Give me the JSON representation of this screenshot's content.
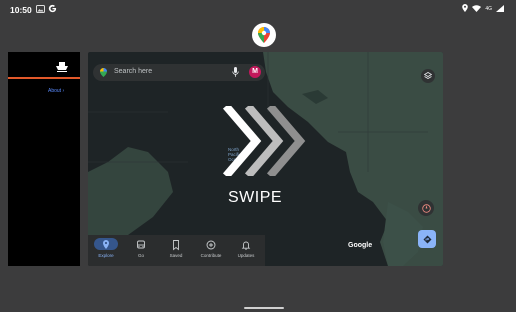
{
  "status_bar": {
    "time": "10:50",
    "network": "4G"
  },
  "left_card": {
    "about_link": "About ›"
  },
  "maps": {
    "search_placeholder": "Search here",
    "avatar_letter": "M",
    "swipe_label": "SWIPE",
    "attribution": "Google",
    "ocean_label": "North\nPacific\nOcean",
    "nav": [
      {
        "label": "Explore",
        "icon": "pin-icon",
        "active": true
      },
      {
        "label": "Go",
        "icon": "car-icon",
        "active": false
      },
      {
        "label": "Saved",
        "icon": "bookmark-icon",
        "active": false
      },
      {
        "label": "Contribute",
        "icon": "plus-circle-icon",
        "active": false
      },
      {
        "label": "Updates",
        "icon": "bell-icon",
        "active": false
      }
    ]
  },
  "colors": {
    "background": "#3c3c3d",
    "map_base": "#1e2426",
    "accent_blue": "#8ab4f8",
    "avatar": "#c2185b",
    "orange_bar": "#e2592a"
  }
}
